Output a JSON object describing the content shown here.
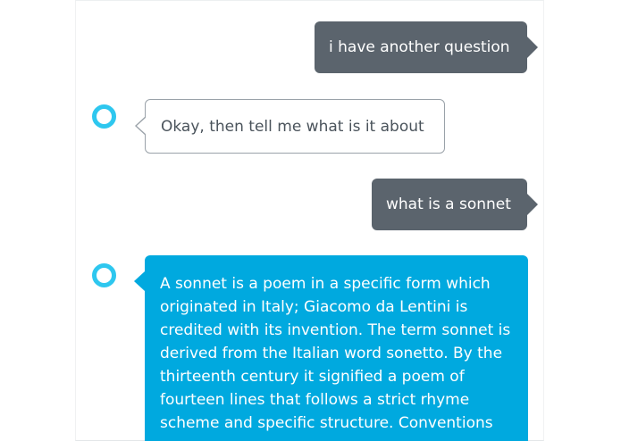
{
  "conversation": {
    "messages": [
      {
        "sender": "user",
        "text": "i have another question"
      },
      {
        "sender": "alexa",
        "text": "Okay, then tell me what is it about"
      },
      {
        "sender": "user",
        "text": "what is a sonnet"
      },
      {
        "sender": "alexa",
        "text": "A sonnet is a poem in a specific form which originated in Italy; Giacomo da Lentini is credited with its invention. The term sonnet is derived from the Italian word sonetto. By the thirteenth century it signified a poem of fourteen lines that follows a strict rhyme scheme and specific structure. Conventions"
      }
    ]
  },
  "colors": {
    "user_bubble": "#5b646d",
    "alexa_bubble": "#00a9df",
    "alexa_ring": "#2ec7ef",
    "outline": "#9aa2a9"
  },
  "icons": {
    "alexa_avatar": "alexa-ring-icon"
  }
}
